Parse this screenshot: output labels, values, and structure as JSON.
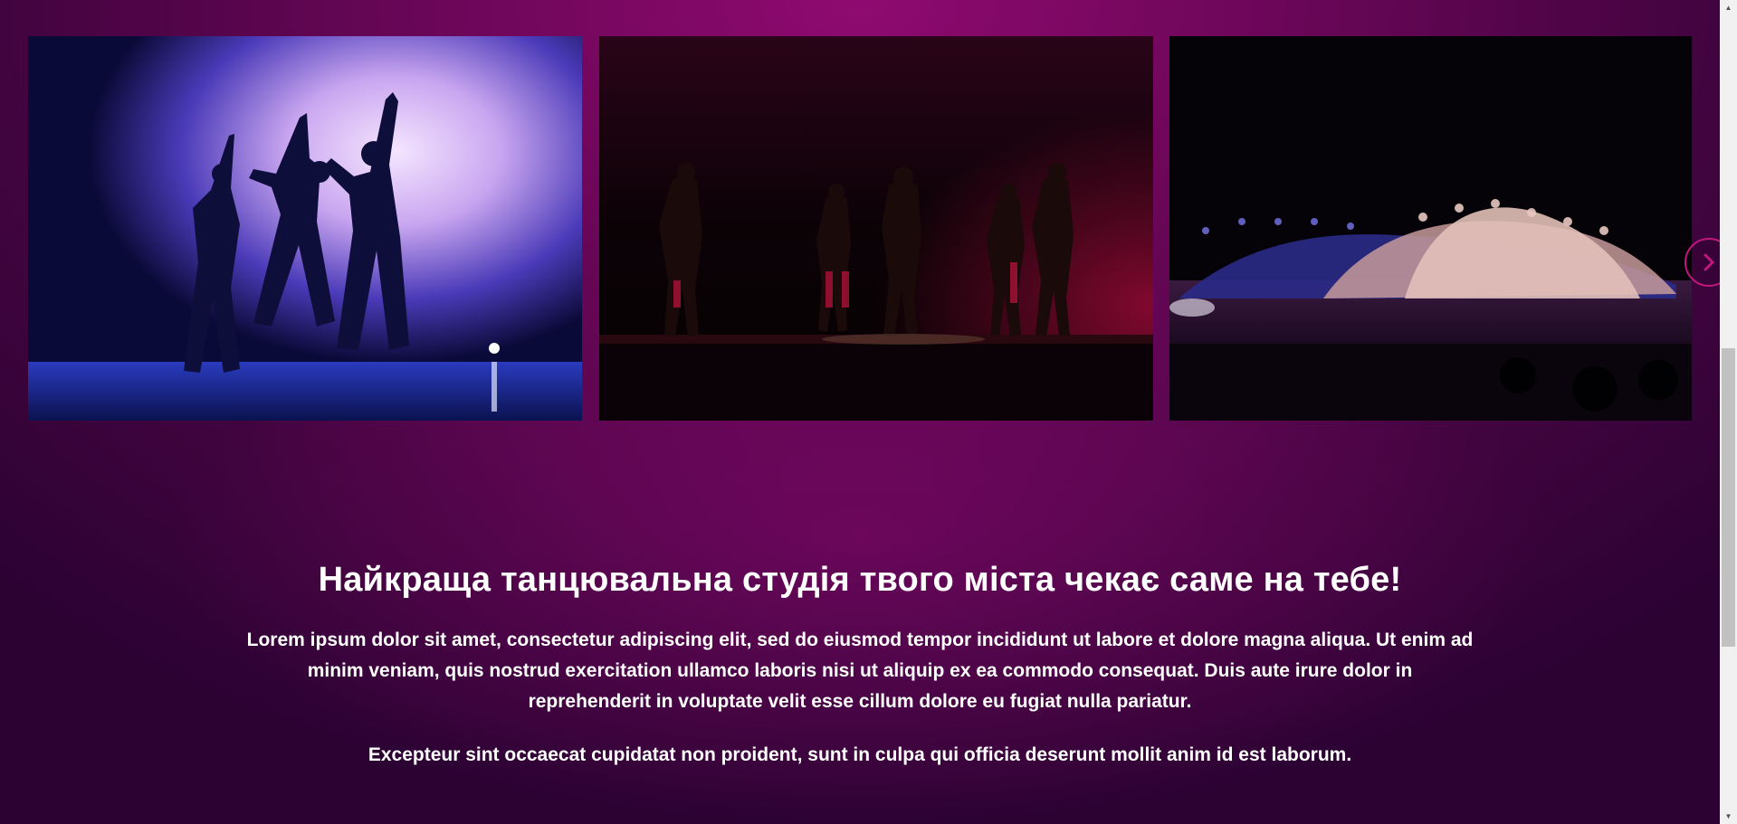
{
  "gallery": {
    "photos": [
      {
        "icon": "dance-photo-smoke-stage"
      },
      {
        "icon": "dance-photo-dark-stage"
      },
      {
        "icon": "dance-photo-ballet-line"
      }
    ],
    "next_icon": "chevron-right-icon"
  },
  "promo": {
    "heading": "Найкраща танцювальна студія твого міста чекає саме на тебе!",
    "paragraph1": "Lorem ipsum dolor sit amet, consectetur adipiscing elit, sed do eiusmod tempor incididunt ut labore et dolore magna aliqua. Ut enim ad minim veniam, quis nostrud exercitation ullamco laboris nisi ut aliquip ex ea commodo consequat. Duis aute irure dolor in reprehenderit in voluptate velit esse cillum dolore eu fugiat nulla pariatur.",
    "paragraph2": "Excepteur sint occaecat cupidatat non proident, sunt in culpa qui officia deserunt mollit anim id est laborum."
  },
  "scrollbar": {
    "up_glyph": "▲",
    "down_glyph": "▼"
  },
  "colors": {
    "accent": "#c0167d",
    "background_center": "#8f0a70",
    "background_edge": "#2c0233",
    "text": "#ffffff"
  }
}
